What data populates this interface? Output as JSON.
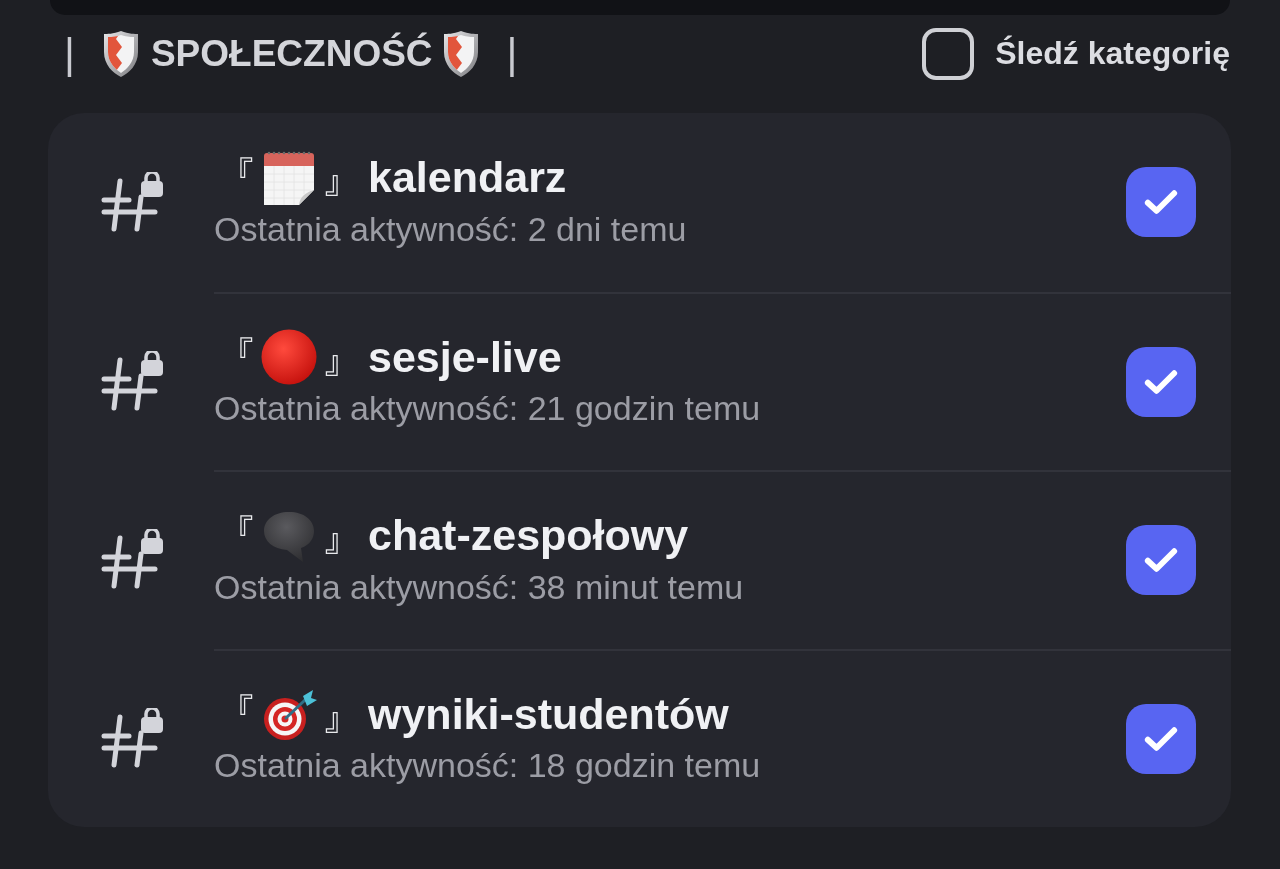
{
  "category": {
    "bar_left": "|",
    "title": "SPOŁECZNOŚĆ",
    "bar_right": "|",
    "follow": {
      "label": "Śledź kategorię",
      "checked": false
    }
  },
  "channels": [
    {
      "open_bracket": "『",
      "close_bracket": "』",
      "name": "kalendarz",
      "activity": "Ostatnia aktywność: 2 dni temu",
      "locked": true,
      "checked": true
    },
    {
      "open_bracket": "『",
      "close_bracket": "』",
      "name": "sesje-live",
      "activity": "Ostatnia aktywność: 21 godzin temu",
      "locked": true,
      "checked": true
    },
    {
      "open_bracket": "『",
      "close_bracket": "』",
      "name": "chat-zespołowy",
      "activity": "Ostatnia aktywność: 38 minut temu",
      "locked": true,
      "checked": true
    },
    {
      "open_bracket": "『",
      "close_bracket": "』",
      "name": "wyniki-studentów",
      "activity": "Ostatnia aktywność: 18 godzin temu",
      "locked": true,
      "checked": true
    }
  ]
}
